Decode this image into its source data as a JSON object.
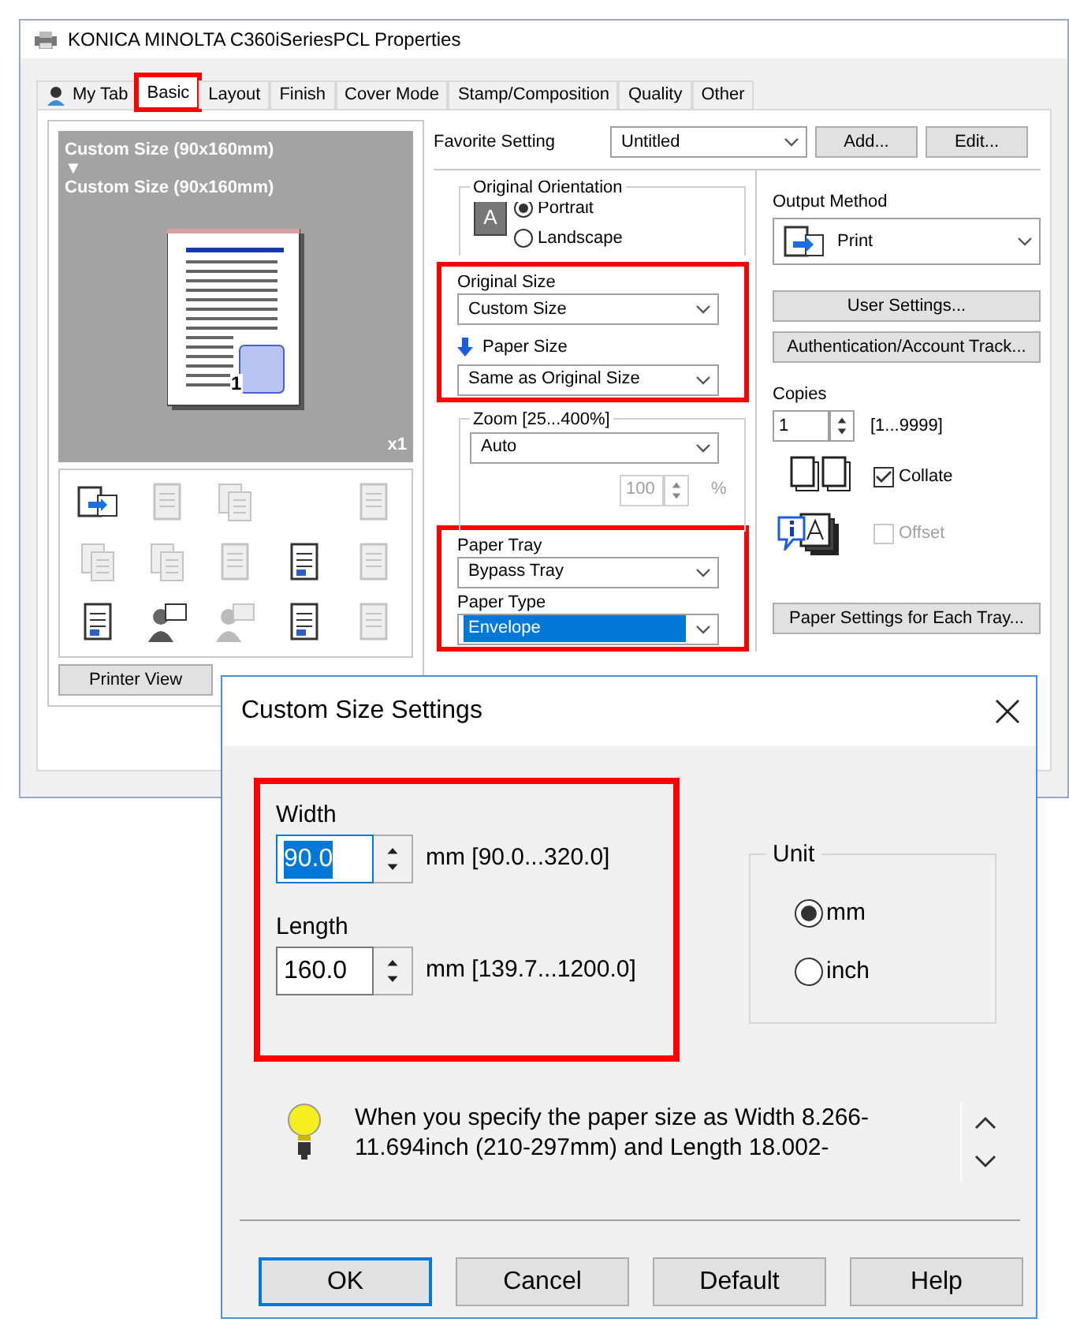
{
  "window": {
    "title": "KONICA MINOLTA C360iSeriesPCL Properties"
  },
  "tabs": [
    {
      "label": "My Tab",
      "kind": "icon",
      "selected": false,
      "highlighted": false
    },
    {
      "label": "Basic",
      "kind": "plain",
      "selected": true,
      "highlighted": true
    },
    {
      "label": "Layout",
      "kind": "plain",
      "selected": false,
      "highlighted": false
    },
    {
      "label": "Finish",
      "kind": "plain",
      "selected": false,
      "highlighted": false
    },
    {
      "label": "Cover Mode",
      "kind": "plain",
      "selected": false,
      "highlighted": false
    },
    {
      "label": "Stamp/Composition",
      "kind": "plain",
      "selected": false,
      "highlighted": false
    },
    {
      "label": "Quality",
      "kind": "plain",
      "selected": false,
      "highlighted": false
    },
    {
      "label": "Other",
      "kind": "plain",
      "selected": false,
      "highlighted": false
    }
  ],
  "preview": {
    "lines": [
      "Custom Size (90x160mm)",
      "▼",
      "Custom Size (90x160mm)"
    ],
    "page_number": "1",
    "copies": "x1"
  },
  "function_icons": [
    {
      "kind": "printer",
      "disabled": false
    },
    {
      "kind": "page",
      "disabled": true
    },
    {
      "kind": "pages",
      "disabled": true
    },
    {
      "kind": "empty"
    },
    {
      "kind": "page",
      "disabled": true
    },
    {
      "kind": "pages",
      "disabled": true
    },
    {
      "kind": "pages",
      "disabled": true
    },
    {
      "kind": "page",
      "disabled": true
    },
    {
      "kind": "page",
      "disabled": false
    },
    {
      "kind": "page",
      "disabled": true
    },
    {
      "kind": "page",
      "disabled": false
    },
    {
      "kind": "person",
      "disabled": false
    },
    {
      "kind": "person",
      "disabled": true
    },
    {
      "kind": "page",
      "disabled": false
    },
    {
      "kind": "page",
      "disabled": true
    }
  ],
  "printer_view_button": "Printer View",
  "favorite": {
    "label": "Favorite Setting",
    "value": "Untitled",
    "buttons": [
      "Add...",
      "Edit..."
    ]
  },
  "orientation": {
    "title": "Original Orientation",
    "icon_letter": "A",
    "options": [
      {
        "label": "Portrait",
        "selected": true
      },
      {
        "label": "Landscape",
        "selected": false
      }
    ]
  },
  "size_group": {
    "highlighted": true,
    "original_size": {
      "label": "Original Size",
      "value": "Custom Size"
    },
    "paper_size": {
      "label": "Paper Size",
      "value": "Same as Original Size"
    }
  },
  "zoom": {
    "title": "Zoom [25...400%]",
    "value": "Auto",
    "percent": "100",
    "unit": "%",
    "disabled": true
  },
  "tray_group": {
    "highlighted": true,
    "paper_tray": {
      "label": "Paper Tray",
      "value": "Bypass Tray",
      "focused": false
    },
    "paper_type": {
      "label": "Paper Type",
      "value": "Envelope",
      "focused": true
    }
  },
  "output_method": {
    "label": "Output Method",
    "value": "Print"
  },
  "side_buttons": [
    "User Settings...",
    "Authentication/Account Track..."
  ],
  "copies": {
    "label": "Copies",
    "value": "1",
    "range": "[1...9999]"
  },
  "collate": {
    "label": "Collate",
    "checked": true,
    "disabled": false
  },
  "offset": {
    "label": "Offset",
    "checked": false,
    "disabled": true
  },
  "tray_button": "Paper Settings for Each Tray...",
  "dialog": {
    "title": "Custom Size Settings",
    "highlighted": true,
    "fields": [
      {
        "label": "Width",
        "value": "90.0",
        "text_selected": true,
        "range": "mm [90.0...320.0]"
      },
      {
        "label": "Length",
        "value": "160.0",
        "text_selected": false,
        "range": "mm [139.7...1200.0]"
      }
    ],
    "unit": {
      "title": "Unit",
      "options": [
        {
          "label": "mm",
          "selected": true
        },
        {
          "label": "inch",
          "selected": false
        }
      ]
    },
    "message": "When you specify the paper size as Width 8.266-\n11.694inch (210-297mm) and Length 18.002-",
    "buttons": [
      {
        "label": "OK",
        "default": true
      },
      {
        "label": "Cancel",
        "default": false
      },
      {
        "label": "Default",
        "default": false
      },
      {
        "label": "Help",
        "default": false
      }
    ]
  }
}
